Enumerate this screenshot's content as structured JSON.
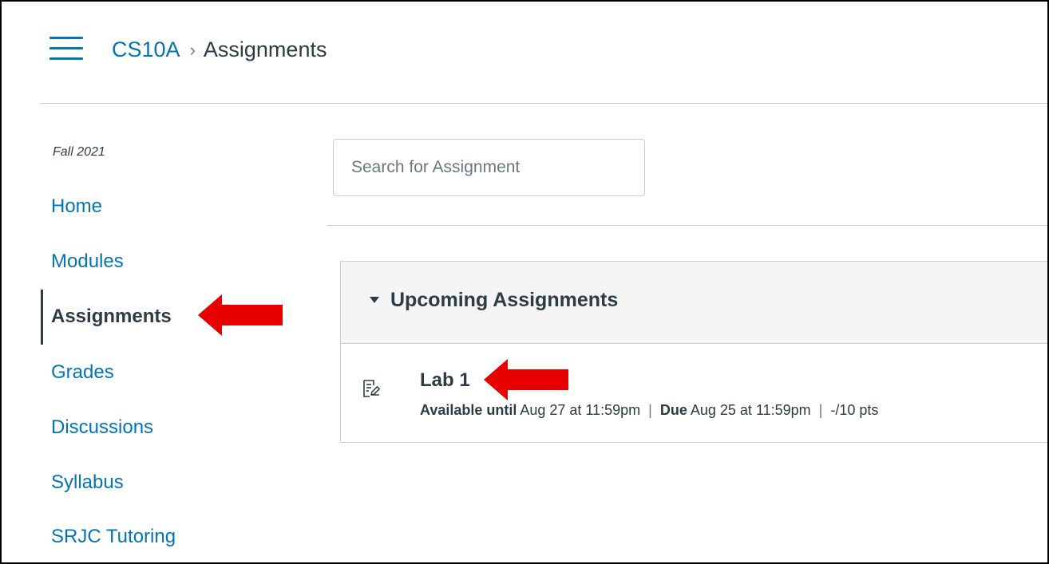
{
  "header": {
    "course": "CS10A",
    "separator": "›",
    "current_page": "Assignments"
  },
  "sidebar": {
    "term": "Fall 2021",
    "items": [
      {
        "label": "Home",
        "active": false
      },
      {
        "label": "Modules",
        "active": false
      },
      {
        "label": "Assignments",
        "active": true
      },
      {
        "label": "Grades",
        "active": false
      },
      {
        "label": "Discussions",
        "active": false
      },
      {
        "label": "Syllabus",
        "active": false
      },
      {
        "label": "SRJC Tutoring",
        "active": false
      }
    ]
  },
  "search": {
    "placeholder": "Search for Assignment",
    "value": ""
  },
  "assignment_groups": [
    {
      "title": "Upcoming Assignments",
      "assignments": [
        {
          "title": "Lab 1",
          "available_label": "Available until",
          "available_value": "Aug 27 at 11:59pm",
          "due_label": "Due",
          "due_value": "Aug 25 at 11:59pm",
          "points": "-/10 pts",
          "meta_separator": "|"
        }
      ]
    }
  ],
  "icons": {
    "menu": "hamburger-menu-icon",
    "caret": "caret-down-icon",
    "assignment": "assignment-icon",
    "annotation_arrow": "red-arrow-icon"
  },
  "colors": {
    "link": "#0374b5",
    "text": "#2d3b45",
    "header_bg": "#f5f5f5",
    "border": "#c7cdd1",
    "annotation": "#e60000"
  }
}
